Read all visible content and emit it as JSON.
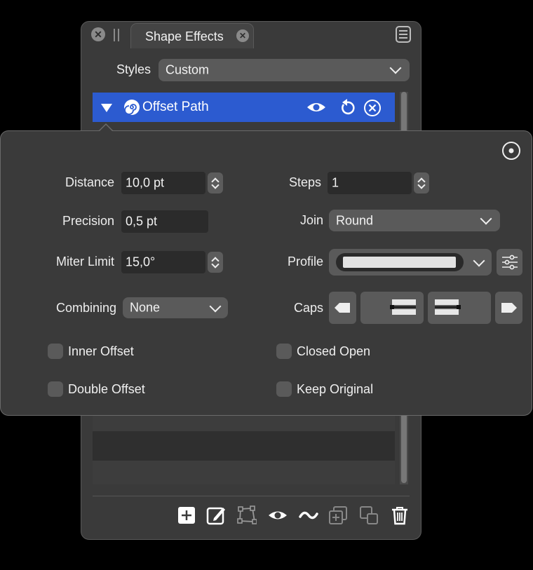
{
  "panel": {
    "tab_title": "Shape Effects",
    "styles_label": "Styles",
    "styles_value": "Custom",
    "effect_row": {
      "name": "Offset Path"
    }
  },
  "popover": {
    "distance": {
      "label": "Distance",
      "value": "10,0 pt"
    },
    "precision": {
      "label": "Precision",
      "value": "0,5 pt"
    },
    "miter_limit": {
      "label": "Miter Limit",
      "value": "15,0°"
    },
    "combining": {
      "label": "Combining",
      "value": "None"
    },
    "steps": {
      "label": "Steps",
      "value": "1"
    },
    "join": {
      "label": "Join",
      "value": "Round"
    },
    "profile": {
      "label": "Profile"
    },
    "caps": {
      "label": "Caps"
    },
    "checks": {
      "inner_offset": "Inner Offset",
      "double_offset": "Double Offset",
      "closed_open": "Closed Open",
      "keep_original": "Keep Original"
    }
  },
  "colors": {
    "accent": "#2c5bd0",
    "panel": "#3a3a3a"
  },
  "icons": [
    "close-icon",
    "tab-close-icon",
    "menu-icon",
    "chevron-down-icon",
    "disclosure-triangle-icon",
    "spiral-icon",
    "eye-icon",
    "reset-icon",
    "remove-icon",
    "target-icon",
    "stepper-icon",
    "settings-sliders-icon",
    "add-icon",
    "edit-icon",
    "path-icon",
    "eye-icon",
    "wave-icon",
    "duplicate-icon",
    "copy-icon",
    "trash-icon"
  ]
}
